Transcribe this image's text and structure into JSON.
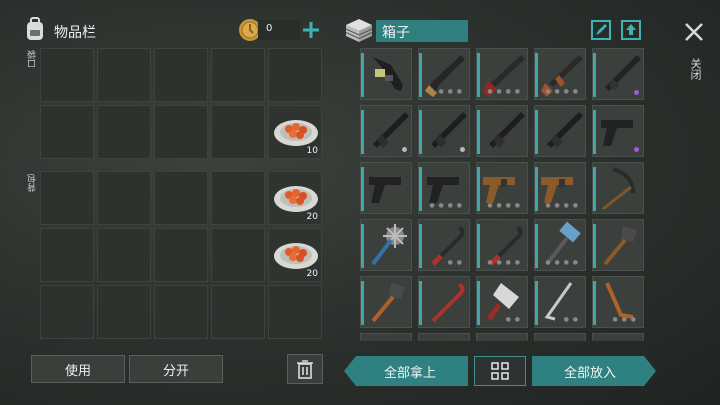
{
  "inventory": {
    "title": "物品栏",
    "coin_value": "0",
    "pocket_label": "口袋",
    "backpack_label": "背包",
    "pocket_items": [
      {
        "qty": "10"
      }
    ],
    "backpack_items": [
      {
        "qty": "20"
      },
      {
        "qty": "20"
      }
    ],
    "use_label": "使用",
    "split_label": "分开"
  },
  "container": {
    "title": "箱子",
    "take_all_label": "全部拿上",
    "put_all_label": "全部放入"
  },
  "close_label": "关闭",
  "icons": {
    "backpack": "backpack-icon",
    "coin": "coin-icon",
    "add": "plus-icon",
    "box": "crate-icon",
    "edit": "edit-icon",
    "upload": "upload-icon",
    "close": "close-icon",
    "trash": "trash-icon",
    "sort": "sort-grid-icon"
  },
  "colors": {
    "accent": "#3fa7a7",
    "rare_dot": "#a05ad8",
    "uncommon_dot": "#b8b8b8"
  }
}
